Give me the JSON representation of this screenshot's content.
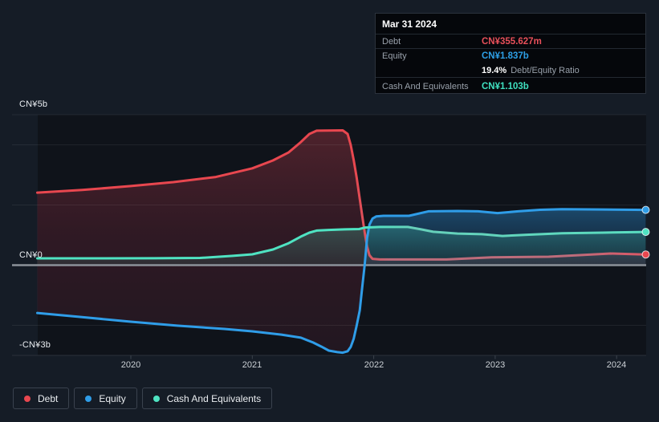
{
  "axis": {
    "y_labels": [
      {
        "text": "CN¥5b",
        "value": 5
      },
      {
        "text": "CN¥0",
        "value": 0
      },
      {
        "text": "-CN¥3b",
        "value": -3
      }
    ],
    "x_labels": [
      {
        "text": "2020",
        "year": 2020
      },
      {
        "text": "2021",
        "year": 2021
      },
      {
        "text": "2022",
        "year": 2022
      },
      {
        "text": "2023",
        "year": 2023
      },
      {
        "text": "2024",
        "year": 2024
      }
    ]
  },
  "tooltip": {
    "date": "Mar 31 2024",
    "debt_label": "Debt",
    "debt_value": "CN¥355.627m",
    "equity_label": "Equity",
    "equity_value": "CN¥1.837b",
    "ratio_value": "19.4%",
    "ratio_label": "Debt/Equity Ratio",
    "cash_label": "Cash And Equivalents",
    "cash_value": "CN¥1.103b"
  },
  "legend": {
    "items": [
      {
        "label": "Debt",
        "color": "#e8474f"
      },
      {
        "label": "Equity",
        "color": "#2f9de8"
      },
      {
        "label": "Cash And Equivalents",
        "color": "#4fe3c2"
      }
    ]
  },
  "colors": {
    "page_bg": "#151c26",
    "plot_bg": "#0f131a",
    "zero_line": "#8b9199",
    "debt": "#e8474f",
    "debt_muted": "#bd6c7b",
    "equity": "#2f9de8",
    "cash": "#4fe3c2"
  },
  "chart_data": {
    "type": "area",
    "x_unit": "year",
    "y_unit": "CN¥ billions",
    "xlim": [
      2019.23,
      2024.25
    ],
    "ylim": [
      -3,
      5
    ],
    "grid": true,
    "gridline_values": [
      5,
      4,
      2,
      0,
      -2,
      -3
    ],
    "x_ticks": [
      2020,
      2021,
      2022,
      2023,
      2024
    ],
    "legend_position": "bottom-left",
    "end_values": {
      "debt_b": 0.3556,
      "equity_b": 1.837,
      "cash_b": 1.103,
      "debt_equity_ratio_pct": 19.4
    },
    "series": [
      {
        "name": "Debt",
        "color": "#e8474f",
        "points": [
          [
            2019.23,
            2.41
          ],
          [
            2019.6,
            2.5
          ],
          [
            2020.0,
            2.63
          ],
          [
            2020.35,
            2.76
          ],
          [
            2020.7,
            2.93
          ],
          [
            2021.0,
            3.22
          ],
          [
            2021.17,
            3.48
          ],
          [
            2021.3,
            3.75
          ],
          [
            2021.4,
            4.09
          ],
          [
            2021.47,
            4.36
          ],
          [
            2021.53,
            4.47
          ],
          [
            2021.745,
            4.48
          ],
          [
            2021.785,
            4.36
          ],
          [
            2021.81,
            4.0
          ],
          [
            2021.835,
            3.5
          ],
          [
            2021.86,
            2.9
          ],
          [
            2021.885,
            2.2
          ],
          [
            2021.905,
            1.65
          ],
          [
            2021.925,
            1.1
          ],
          [
            2021.945,
            0.62
          ],
          [
            2021.965,
            0.33
          ],
          [
            2021.99,
            0.21
          ],
          [
            2022.05,
            0.19
          ],
          [
            2022.6,
            0.19
          ],
          [
            2022.97,
            0.26
          ],
          [
            2023.44,
            0.28
          ],
          [
            2023.95,
            0.387
          ],
          [
            2024.24,
            0.3556
          ]
        ]
      },
      {
        "name": "Equity",
        "color": "#2f9de8",
        "points": [
          [
            2019.23,
            -1.59
          ],
          [
            2019.58,
            -1.72
          ],
          [
            2020.0,
            -1.88
          ],
          [
            2020.38,
            -2.01
          ],
          [
            2020.77,
            -2.12
          ],
          [
            2021.0,
            -2.2
          ],
          [
            2021.24,
            -2.31
          ],
          [
            2021.4,
            -2.41
          ],
          [
            2021.5,
            -2.57
          ],
          [
            2021.57,
            -2.71
          ],
          [
            2021.63,
            -2.84
          ],
          [
            2021.7,
            -2.89
          ],
          [
            2021.745,
            -2.91
          ],
          [
            2021.785,
            -2.86
          ],
          [
            2021.81,
            -2.72
          ],
          [
            2021.835,
            -2.45
          ],
          [
            2021.86,
            -2.0
          ],
          [
            2021.885,
            -1.5
          ],
          [
            2021.905,
            -0.75
          ],
          [
            2021.925,
            0.0
          ],
          [
            2021.945,
            0.9
          ],
          [
            2021.965,
            1.35
          ],
          [
            2021.99,
            1.55
          ],
          [
            2022.02,
            1.62
          ],
          [
            2022.08,
            1.64
          ],
          [
            2022.29,
            1.64
          ],
          [
            2022.45,
            1.79
          ],
          [
            2022.69,
            1.8
          ],
          [
            2022.86,
            1.79
          ],
          [
            2023.02,
            1.73
          ],
          [
            2023.19,
            1.79
          ],
          [
            2023.37,
            1.84
          ],
          [
            2023.55,
            1.86
          ],
          [
            2023.88,
            1.85
          ],
          [
            2024.24,
            1.837
          ]
        ]
      },
      {
        "name": "Cash And Equivalents",
        "color": "#4fe3c2",
        "points": [
          [
            2019.23,
            0.227
          ],
          [
            2019.7,
            0.227
          ],
          [
            2020.2,
            0.23
          ],
          [
            2020.57,
            0.24
          ],
          [
            2020.84,
            0.31
          ],
          [
            2021.0,
            0.36
          ],
          [
            2021.17,
            0.52
          ],
          [
            2021.3,
            0.73
          ],
          [
            2021.4,
            0.95
          ],
          [
            2021.47,
            1.08
          ],
          [
            2021.53,
            1.15
          ],
          [
            2021.63,
            1.17
          ],
          [
            2021.76,
            1.19
          ],
          [
            2021.88,
            1.2
          ],
          [
            2021.93,
            1.25
          ],
          [
            2022.05,
            1.27
          ],
          [
            2022.28,
            1.27
          ],
          [
            2022.39,
            1.19
          ],
          [
            2022.49,
            1.11
          ],
          [
            2022.69,
            1.05
          ],
          [
            2022.89,
            1.03
          ],
          [
            2023.06,
            0.97
          ],
          [
            2023.26,
            1.01
          ],
          [
            2023.55,
            1.06
          ],
          [
            2023.88,
            1.08
          ],
          [
            2024.24,
            1.103
          ]
        ]
      }
    ]
  }
}
